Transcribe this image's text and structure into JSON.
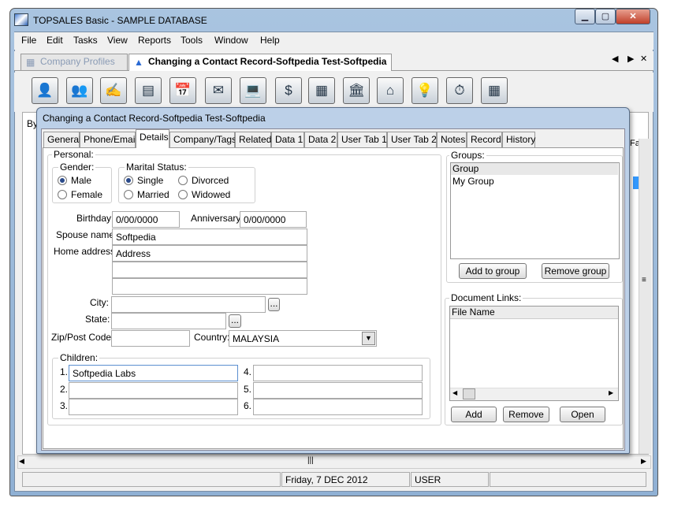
{
  "window": {
    "title": "TOPSALES Basic - SAMPLE DATABASE",
    "min": "▁",
    "max": "▢",
    "close": "✕"
  },
  "menu": [
    "File",
    "Edit",
    "Tasks",
    "View",
    "Reports",
    "Tools",
    "Window",
    "Help"
  ],
  "doc_tabs": [
    {
      "label": "Company Profiles",
      "icon": "grid-icon"
    },
    {
      "label": "Changing a Contact Record-Softpedia Test-Softpedia",
      "icon": "contact-icon"
    }
  ],
  "doc_nav": {
    "prev": "◀",
    "next": "▶",
    "close": "✕"
  },
  "toolbar_icons": [
    "contact-icon",
    "people-icon",
    "pen-icon",
    "form-icon",
    "calendar-icon",
    "letter-icon",
    "computer-icon",
    "dollar-icon",
    "register-icon",
    "bank-icon",
    "shop-icon",
    "lamp-icon",
    "timer-icon",
    "calculator-icon"
  ],
  "toolbar_glyphs": [
    "👤",
    "👥",
    "✍",
    "▤",
    "📅",
    "✉",
    "💻",
    "$",
    "▦",
    "🏛",
    "⌂",
    "💡",
    "⏱",
    "▦"
  ],
  "background": {
    "by_label": "By",
    "fa_label": "Fa"
  },
  "status": {
    "date": "Friday,  7 DEC 2012",
    "user": "USER"
  },
  "dialog": {
    "title": "Changing a Contact Record-Softpedia Test-Softpedia",
    "tabs": [
      "General",
      "Phone/Email",
      "Details",
      "Company/Tags",
      "Related",
      "Data 1",
      "Data 2",
      "User Tab 1",
      "User Tab 2",
      "Notes",
      "Record",
      "History"
    ],
    "active_tab": "Details",
    "personal": {
      "label": "Personal:",
      "gender": {
        "label": "Gender:",
        "options": [
          "Male",
          "Female"
        ],
        "selected": "Male"
      },
      "marital": {
        "label": "Marital Status:",
        "options": [
          "Single",
          "Divorced",
          "Married",
          "Widowed"
        ],
        "selected": "Single"
      },
      "birthday": {
        "label": "Birthday:",
        "value": "0/00/0000"
      },
      "anniversary": {
        "label": "Anniversary:",
        "value": "0/00/0000"
      },
      "spouse": {
        "label": "Spouse name:",
        "value": "Softpedia"
      },
      "home_address": {
        "label": "Home address:",
        "lines": [
          "Address",
          "",
          ""
        ]
      },
      "city": {
        "label": "City:",
        "value": ""
      },
      "state": {
        "label": "State:",
        "value": ""
      },
      "zip": {
        "label": "Zip/Post Code:",
        "value": ""
      },
      "country": {
        "label": "Country:",
        "value": "MALAYSIA"
      },
      "ellipsis": "..."
    },
    "children": {
      "label": "Children:",
      "items": [
        {
          "n": "1.",
          "value": "Softpedia Labs"
        },
        {
          "n": "2.",
          "value": ""
        },
        {
          "n": "3.",
          "value": ""
        },
        {
          "n": "4.",
          "value": ""
        },
        {
          "n": "5.",
          "value": ""
        },
        {
          "n": "6.",
          "value": ""
        }
      ]
    },
    "groups": {
      "label": "Groups:",
      "items": [
        "Group",
        "My Group"
      ],
      "add": "Add to group",
      "remove": "Remove group"
    },
    "documents": {
      "label": "Document Links:",
      "header": "File Name",
      "add": "Add",
      "remove": "Remove",
      "open": "Open"
    }
  }
}
